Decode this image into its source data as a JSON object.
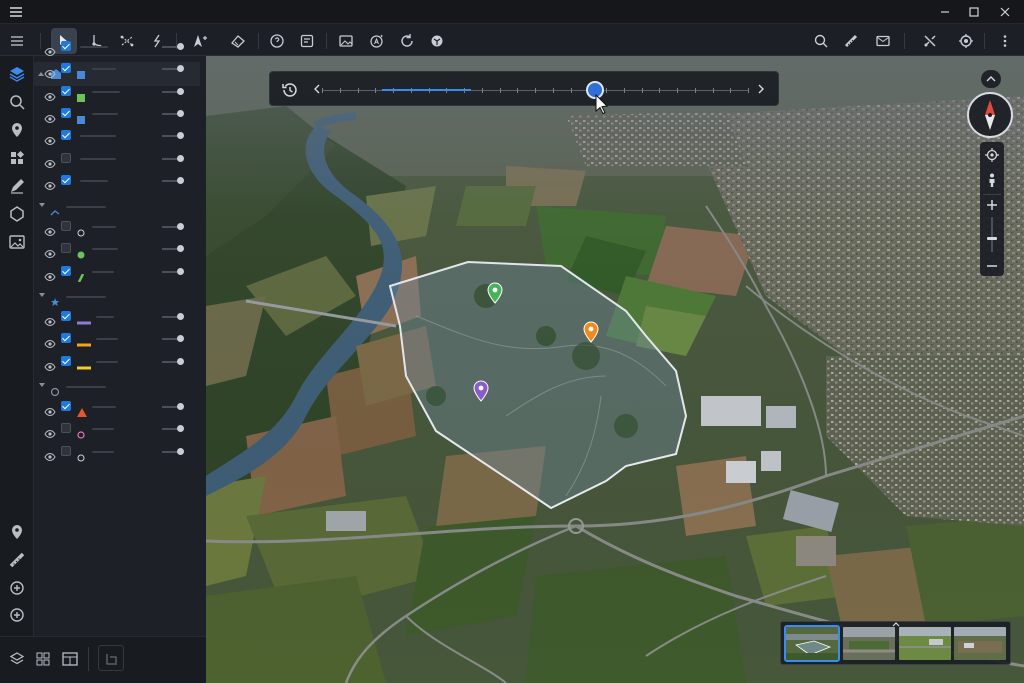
{
  "colors": {
    "accent": "#3b8cf0",
    "checkbox_on": "#1f7ae0",
    "pin_green": "#46b35a",
    "pin_orange": "#f08a1c",
    "pin_purple": "#8a5cc8",
    "layer_blue": "#4a88d8",
    "layer_green": "#6cc35a",
    "layer_purple": "#8e7cd6",
    "layer_orange": "#f2a41c",
    "layer_yellow": "#f2cc2a",
    "layer_red": "#e8552a"
  },
  "toolbar": {
    "left_tools": [
      "select-arrow-icon",
      "node-edit-icon",
      "vertex-icon",
      "split-icon",
      "add-point-icon",
      "measure-area-icon",
      "help-pin-icon",
      "note-icon",
      "image-icon",
      "text-tool-icon",
      "refresh-icon",
      "settings-3d-icon"
    ],
    "right_tools": [
      "search-icon",
      "ruler-icon",
      "mail-icon",
      "tools-icon",
      "locate-icon",
      "more-vertical-icon"
    ]
  },
  "rail": {
    "items": [
      "layers-icon",
      "search-icon",
      "pin-icon",
      "grid-icon",
      "draw-icon",
      "polygon-icon",
      "image-icon"
    ],
    "bottom_items": [
      "pin-icon",
      "ruler-icon",
      "add-circle-icon",
      "add-icon"
    ]
  },
  "layers": {
    "groups": [
      {
        "id": "group1",
        "rows": [
          {
            "checked": true,
            "symbol": "none"
          },
          {
            "checked": true,
            "symbol": "square-blue"
          },
          {
            "checked": true,
            "symbol": "square-green"
          },
          {
            "checked": true,
            "symbol": "square-blue"
          },
          {
            "checked": true,
            "symbol": "none"
          },
          {
            "checked": false,
            "symbol": "none"
          },
          {
            "checked": true,
            "symbol": "none"
          }
        ]
      },
      {
        "id": "group2",
        "rows": [
          {
            "checked": false,
            "symbol": "circle-outline"
          },
          {
            "checked": false,
            "symbol": "circle-green"
          },
          {
            "checked": true,
            "symbol": "bar-green"
          }
        ]
      },
      {
        "id": "group3",
        "rows": [
          {
            "checked": true,
            "symbol": "line-purple"
          },
          {
            "checked": true,
            "symbol": "line-orange"
          },
          {
            "checked": true,
            "symbol": "line-yellow"
          }
        ]
      },
      {
        "id": "group4",
        "rows": [
          {
            "checked": true,
            "symbol": "triangle-red"
          },
          {
            "checked": false,
            "symbol": "circle-pink"
          },
          {
            "checked": false,
            "symbol": "circle-outline"
          }
        ]
      }
    ]
  },
  "timeline": {
    "position_fraction": 0.64,
    "highlight_start_fraction": 0.14,
    "highlight_end_fraction": 0.35
  },
  "bottom_bar": [
    "layers-icon",
    "grid-icon",
    "table-icon",
    "split-panel-icon"
  ],
  "filmstrip": {
    "count": 4,
    "selected_index": 0
  }
}
